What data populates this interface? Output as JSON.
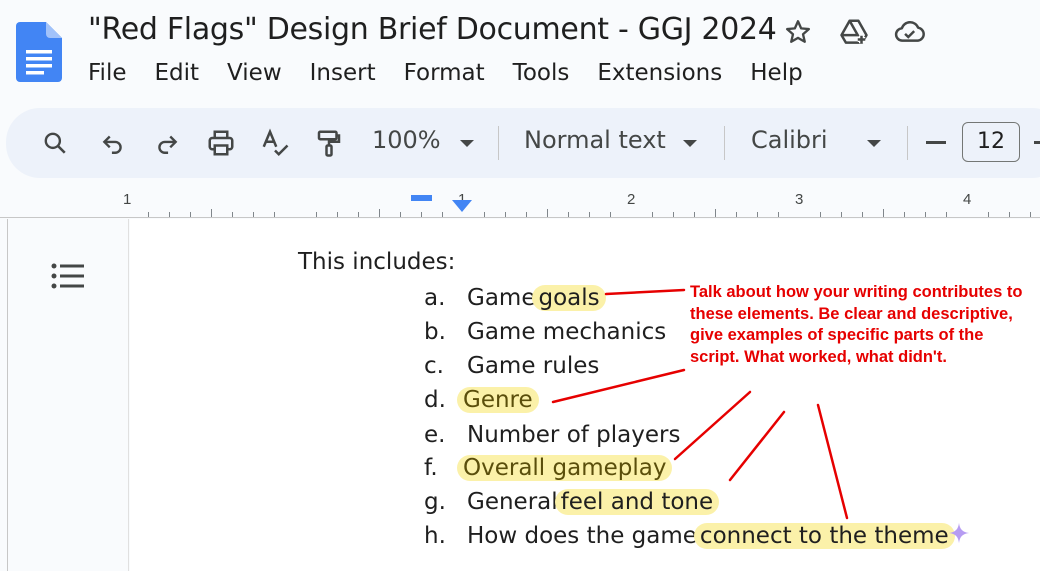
{
  "app": {
    "document_title": "\"Red Flags\" Design Brief Document - GGJ 2024"
  },
  "title_icons": [
    "star-icon",
    "move-to-drive-icon",
    "cloud-status-icon"
  ],
  "menubar": {
    "items": [
      "File",
      "Edit",
      "View",
      "Insert",
      "Format",
      "Tools",
      "Extensions",
      "Help"
    ]
  },
  "toolbar": {
    "zoom": "100%",
    "paragraph_style": "Normal text",
    "font": "Calibri",
    "font_size": "12",
    "icons": [
      "search-icon",
      "undo-icon",
      "redo-icon",
      "print-icon",
      "spellcheck-icon",
      "paint-format-icon"
    ]
  },
  "ruler": {
    "labels": [
      "1",
      "1",
      "2",
      "3",
      "4"
    ]
  },
  "document": {
    "intro": "This includes:",
    "list": [
      {
        "letter": "a.",
        "text": "Game",
        "highlight": "goals"
      },
      {
        "letter": "b.",
        "text": "Game mechanics",
        "highlight": ""
      },
      {
        "letter": "c.",
        "text": "Game rules",
        "highlight": ""
      },
      {
        "letter": "d.",
        "text": "",
        "highlight": "Genre"
      },
      {
        "letter": "e.",
        "text": "Number of players",
        "highlight": ""
      },
      {
        "letter": "f.",
        "text": "",
        "highlight": "Overall gameplay"
      },
      {
        "letter": "g.",
        "text": "General",
        "highlight": "feel and tone"
      },
      {
        "letter": "h.",
        "text": "How does the game",
        "highlight": "connect to the theme"
      }
    ],
    "annotation": "Talk about how your writing contributes to these elements. Be clear and descriptive, give examples of specific parts of the script. What worked, what didn't."
  },
  "colors": {
    "annotation_red": "#e60000",
    "highlight_yellow": "#fbf1a9",
    "docs_blue": "#4285f4",
    "toolbar_bg": "#edf2fa"
  }
}
